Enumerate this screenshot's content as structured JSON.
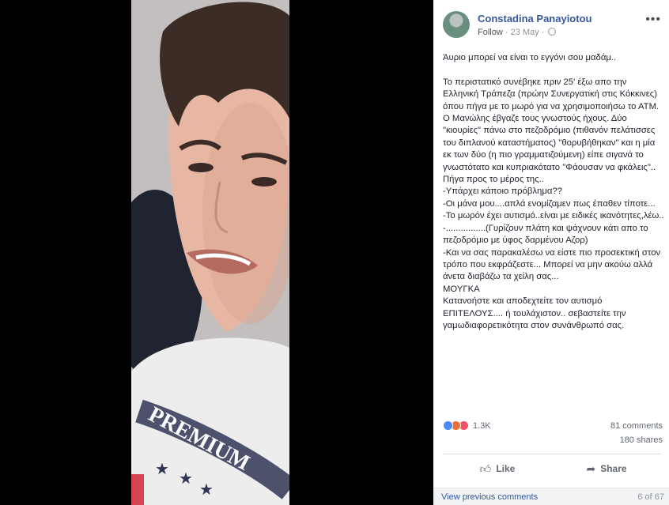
{
  "post": {
    "author": "Constadina Panayiotou",
    "follow_label": "Follow",
    "date": "23 May",
    "text": "Άυριο μπορεί να είναι το εγγόνι σου μαδάμ..\n\nΤο περιστατικό συνέβηκε πριν 25' έξω απο την Ελληνική Τράπεζα (πρώην Συνεργατική στις Κόκκινες) όπου πήγα με το μωρό για να χρησιμοποιήσω το ΑΤΜ. Ο Μανώλης έβγαζε τους γνωστούς ήχους. Δύο \"κιουρίες\" πάνω στο πεζοδρόμιο (πιθανόν πελάτισσες του διπλανού καταστήματος) \"θορυβήθηκαν\" και η μία εκ των δύο (η πιο γραμματιζούμενη) είπε σιγανά το γνωστότατο και κυπριακότατο \"Φάουσαν να φκάλεις\"..\nΠήγα προς το μέρος της..\n-Υπάρχει κάποιο πρόβλημα??\n-Οι μάνα μου....απλά ενομίζαμεν πως έπαθεν τίποτε...\n-Το μωρόν έχει αυτισμό..είναι με ειδικές ικανότητες,λέω..\n-................(Γυρίζουν πλάτη και ψάχνουν κάτι απο το πεζοδρόμιο με ύφος δαρμένου Αζορ)\n-Και να σας παρακαλέσω να είστε πιο προσεκτική στον τρόπο που εκφράζεστε... Μπορεί να μην ακούω αλλά άνετα διαβάζω τα χείλη σας...\nΜΟΥΓΚΑ\nΚατανοήστε και αποδεχτείτε τον αυτισμό ΕΠΙΤΕΛΟΥΣ.... ή τουλάχιστον.. σεβαστείτε την γαμωδιαφορετικότητα στον συνάνθρωπό σας."
  },
  "stats": {
    "reactions_count": "1.3K",
    "comments": "81 comments",
    "shares": "180 shares"
  },
  "actions": {
    "like_label": "Like",
    "share_label": "Share"
  },
  "footer": {
    "view_previous": "View previous comments",
    "comment_count": "6 of 67"
  },
  "icons": {
    "more": "more-options-icon",
    "globe": "public-globe-icon",
    "like": "thumbs-up-icon",
    "share": "share-arrow-icon"
  },
  "colors": {
    "link": "#365899",
    "reaction_like": "#4a8bf5",
    "reaction_angry": "#f0703a",
    "reaction_love": "#f25268"
  },
  "photo": {
    "shirt_text": "PREMIUM"
  }
}
